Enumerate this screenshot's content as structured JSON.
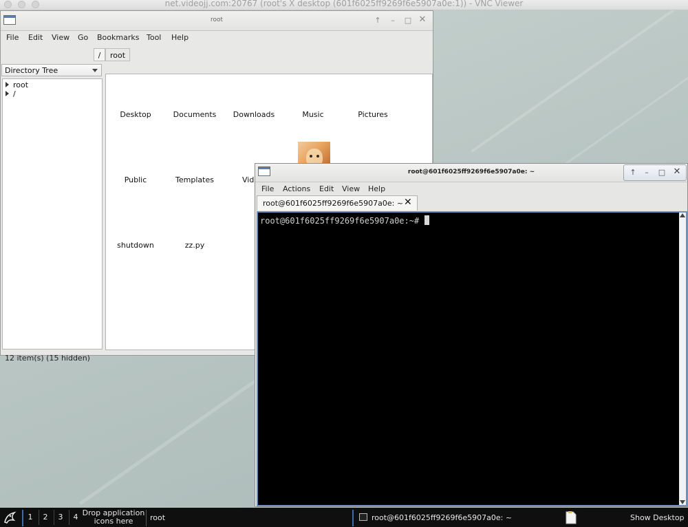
{
  "vnc": {
    "title": "net.videojj.com:20767 (root's X desktop (601f6025ff9269f6e5907a0e:1)) - VNC Viewer"
  },
  "file_manager": {
    "title": "root",
    "menu": [
      "File",
      "Edit",
      "View",
      "Go",
      "Bookmarks",
      "Tool",
      "Help"
    ],
    "path": [
      "/",
      "root"
    ],
    "side_pane_mode": "Directory Tree",
    "tree": [
      "root",
      "/"
    ],
    "files": [
      "Desktop",
      "Documents",
      "Downloads",
      "Music",
      "Pictures",
      "Public",
      "Templates",
      "Vid",
      "shutdown",
      "zz.py"
    ],
    "status": "12 item(s) (15 hidden)"
  },
  "terminal": {
    "title": "root@601f6025ff9269f6e5907a0e: ~",
    "menu": [
      "File",
      "Actions",
      "Edit",
      "View",
      "Help"
    ],
    "tab_label": "root@601f6025ff9269f6e5907a0e: ~",
    "prompt": "root@601f6025ff9269f6e5907a0e:~#"
  },
  "taskbar": {
    "workspaces": [
      "1",
      "2",
      "3",
      "4"
    ],
    "drop_text_line1": "Drop application",
    "drop_text_line2": "icons here",
    "window_fm": "root",
    "window_term": "root@601f6025ff9269f6e5907a0e: ~",
    "show_desktop": "Show Desktop"
  },
  "colors": {
    "accent": "#3d6da8",
    "terminal_bg": "#000000",
    "taskbar_bg": "#0f0f10"
  }
}
